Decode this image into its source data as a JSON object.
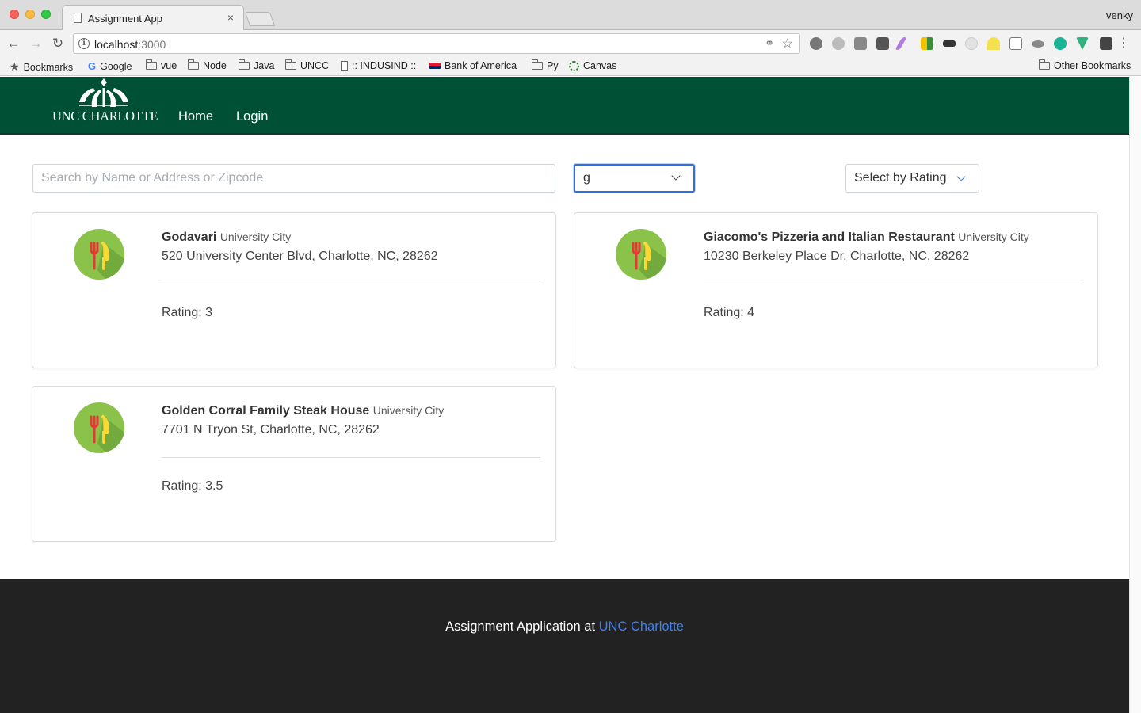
{
  "browser": {
    "tab_title": "Assignment App",
    "tab_close": "×",
    "profile_name": "venky",
    "url_host": "localhost",
    "url_port": ":3000",
    "bookmarks": [
      {
        "label": "Bookmarks",
        "icon": "star-icon"
      },
      {
        "label": "Google",
        "icon": "google-icon"
      },
      {
        "label": "vue",
        "icon": "folder-icon"
      },
      {
        "label": "Node",
        "icon": "folder-icon"
      },
      {
        "label": "Java",
        "icon": "folder-icon"
      },
      {
        "label": "UNCC",
        "icon": "folder-icon"
      },
      {
        "label": ":: INDUSIND ::",
        "icon": "page-icon"
      },
      {
        "label": "Bank of America",
        "icon": "bank-of-america-icon"
      },
      {
        "label": "Py",
        "icon": "folder-icon"
      },
      {
        "label": "Canvas",
        "icon": "canvas-icon"
      }
    ],
    "other_bookmarks": "Other Bookmarks"
  },
  "header": {
    "logo_text": "UNC CHARLOTTE",
    "nav": {
      "home": "Home",
      "login": "Login"
    },
    "background_color": "#005035"
  },
  "filters": {
    "search_placeholder": "Search by Name or Address or Zipcode",
    "search_value": "",
    "cuisine_selected": "g",
    "rating_selected": "Select by Rating"
  },
  "restaurants": [
    {
      "name": "Godavari",
      "area": "University City",
      "address": "520 University Center Blvd, Charlotte, NC, 28262",
      "rating": "Rating: 3"
    },
    {
      "name": "Giacomo's Pizzeria and Italian Restaurant",
      "area": "University City",
      "address": "10230 Berkeley Place Dr, Charlotte, NC, 28262",
      "rating": "Rating: 4"
    },
    {
      "name": "Golden Corral Family Steak House",
      "area": "University City",
      "address": "7701 N Tryon St, Charlotte, NC, 28262",
      "rating": "Rating: 3.5"
    }
  ],
  "footer": {
    "text": "Assignment Application at ",
    "link_text": "UNC Charlotte",
    "link_color": "#3b82f6"
  }
}
